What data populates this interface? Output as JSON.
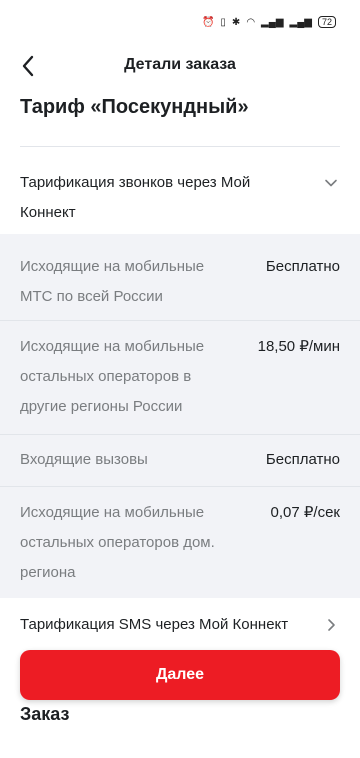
{
  "status_bar": {
    "battery": "72"
  },
  "header": {
    "title": "Детали заказа"
  },
  "tariff": {
    "title": "Тариф «Посекундный»"
  },
  "calls_section": {
    "title": "Тарификация звонков через Мой Коннект",
    "rows": [
      {
        "line1": "Исходящие на мобильные",
        "line2": "МТС по всей России",
        "line3": "",
        "price": "Бесплатно"
      },
      {
        "line1": "Исходящие на мобильные",
        "line2": "остальных операторов в",
        "line3": "другие регионы России",
        "price": "18,50 ₽/мин"
      },
      {
        "line1": "Входящие вызовы",
        "line2": "",
        "line3": "",
        "price": "Бесплатно"
      },
      {
        "line1": "Исходящие на мобильные",
        "line2": "остальных операторов дом.",
        "line3": "региона",
        "price": "0,07 ₽/сек"
      }
    ]
  },
  "sms_section": {
    "title": "Тарификация SMS через Мой Коннект"
  },
  "next_button": {
    "label": "Далее"
  },
  "order": {
    "title": "Заказ"
  },
  "colors": {
    "accent": "#ed1c24",
    "block_bg": "#f2f3f7"
  }
}
